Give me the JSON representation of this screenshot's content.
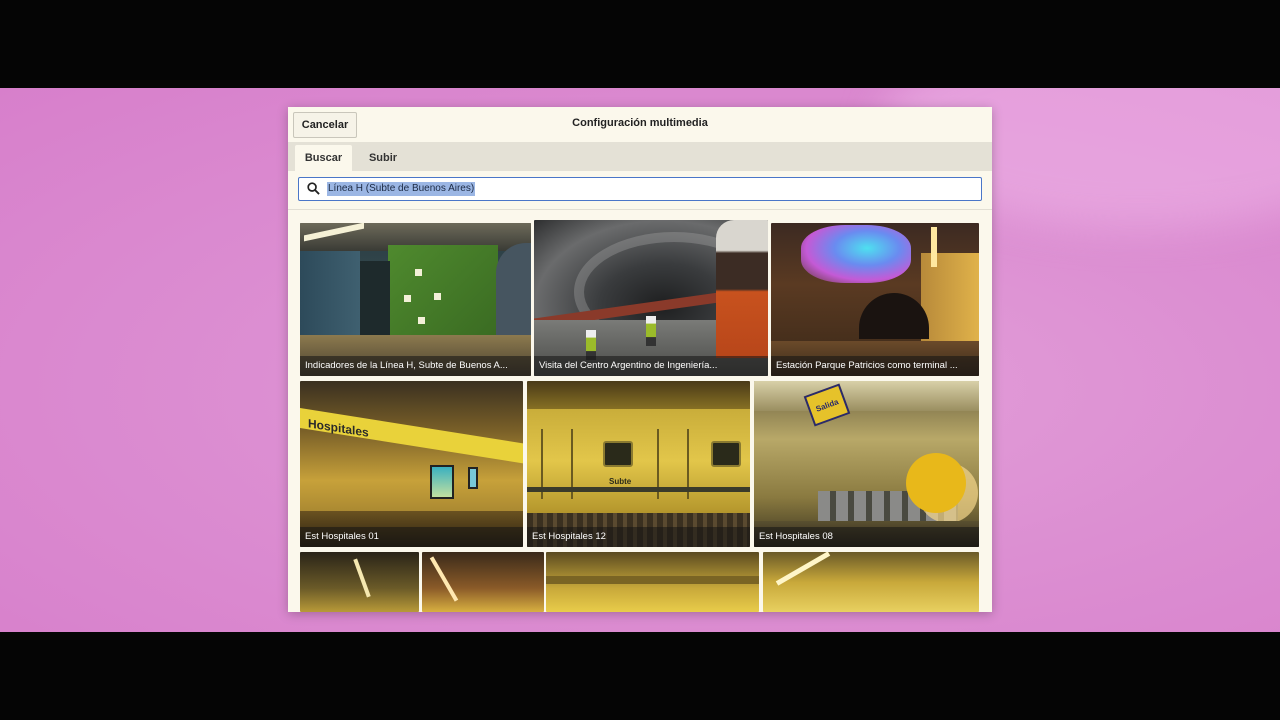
{
  "dialog": {
    "title": "Configuración multimedia",
    "cancel_label": "Cancelar"
  },
  "tabs": [
    {
      "label": "Buscar",
      "active": true
    },
    {
      "label": "Subir",
      "active": false
    }
  ],
  "search": {
    "icon": "search-icon",
    "value": "Línea H (Subte de Buenos Aires)",
    "selected": true
  },
  "results": [
    {
      "caption": "Indicadores de la Línea H, Subte de Buenos A..."
    },
    {
      "caption": "Visita del Centro Argentino de Ingeniería..."
    },
    {
      "caption": "Estación Parque Patricios como terminal ..."
    },
    {
      "caption": "Est Hospitales 01",
      "sign_text": "Hospitales"
    },
    {
      "caption": "Est Hospitales 12",
      "sign_text": "Subte"
    },
    {
      "caption": "Est Hospitales 08",
      "sign_text": "Salida"
    },
    {
      "caption": ""
    },
    {
      "caption": ""
    },
    {
      "caption": ""
    },
    {
      "caption": ""
    }
  ],
  "colors": {
    "dialog_bg": "#fbf8ec",
    "backdrop": "#dc8fd2",
    "search_border": "#4a76c8",
    "selection": "#9bb6e4"
  }
}
